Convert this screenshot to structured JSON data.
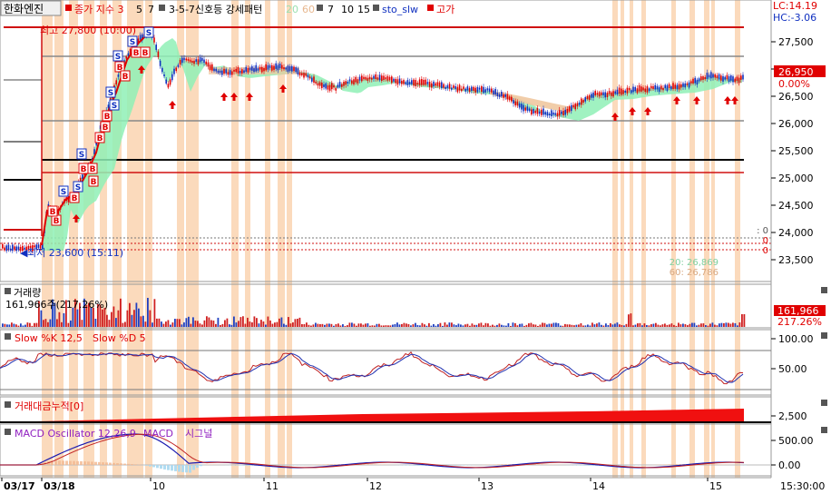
{
  "header": {
    "stock_name": "한화엔진",
    "close_ma_label": "종가 지수 3",
    "ma_periods": [
      "5",
      "7"
    ],
    "pattern_label": "3-5-7신호등 강세패턴",
    "bb_periods": [
      "20",
      "60"
    ],
    "stoch_periods": [
      "7",
      "10",
      "15"
    ],
    "stoch_name": "sto_slw",
    "high_label": "고가"
  },
  "lc_hc": {
    "lc": "LC:14.19",
    "hc": "HC:-3.06"
  },
  "main_panel": {
    "max_label": "최고 27,800 (10:00)",
    "min_label": "최저 23,600 (15:11)",
    "current_price": "26,950",
    "current_pct": "0.00%",
    "y_ticks": [
      "27,500",
      "27,000",
      "26,500",
      "26,000",
      "25,500",
      "25,000",
      "24,500",
      "24,000",
      "23,500"
    ],
    "ma20_label": "20: 26,869",
    "ma60_label": "60: 26,786",
    "side_zero_labels": [
      ": 0",
      "0",
      "0"
    ]
  },
  "volume_panel": {
    "title": "거래량",
    "value_label": "161,966주(217.26%)",
    "current_value": "161,966",
    "current_pct": "217.26%"
  },
  "stoch_panel": {
    "title_k": "Slow %K 12,5",
    "title_d": "Slow %D 5",
    "y_ticks": [
      "100.00",
      "50.00"
    ]
  },
  "cum_panel": {
    "title": "거래대금누적[0]",
    "y_tick": "2,500"
  },
  "macd_panel": {
    "title_osc": "MACD Oscillator 12,26,9",
    "title_macd": "MACD",
    "title_signal": "시그널",
    "y_ticks": [
      "500.00",
      "0.00"
    ]
  },
  "x_axis": {
    "labels": [
      "03/17",
      "03/18",
      "10",
      "11",
      "12",
      "13",
      "14",
      "15"
    ],
    "time": "15:30:00"
  },
  "signal_letters": {
    "buy": "B",
    "sell": "S"
  },
  "colors": {
    "up": "#e00000",
    "down": "#1030c0",
    "highlight": "#f9cda6",
    "cloud_green": "#8ff0b6",
    "cloud_orange": "#f0c8a0",
    "label_red": "#e00000"
  }
}
